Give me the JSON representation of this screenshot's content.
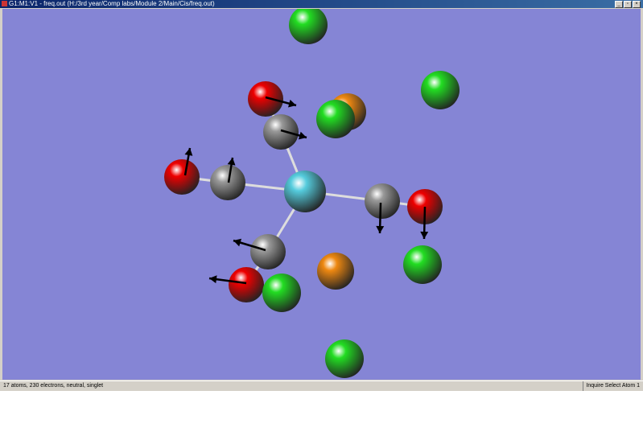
{
  "window": {
    "title": "G1:M1:V1 - freq.out (H:/3rd year/Comp labs/Module 2/Main/Cis/freq.out)",
    "controls": [
      "_",
      "▫",
      "×"
    ]
  },
  "status": {
    "info": "17 atoms, 230 electrons, neutral, singlet",
    "mode": "Inquire Select Atom 1"
  },
  "colors": {
    "background": "#8585d5",
    "chlorine": "#22dd22",
    "phosphorus": "#ee8811",
    "oxygen": "#ee0000",
    "carbon": "#999999",
    "metal": "#55ccdd"
  }
}
